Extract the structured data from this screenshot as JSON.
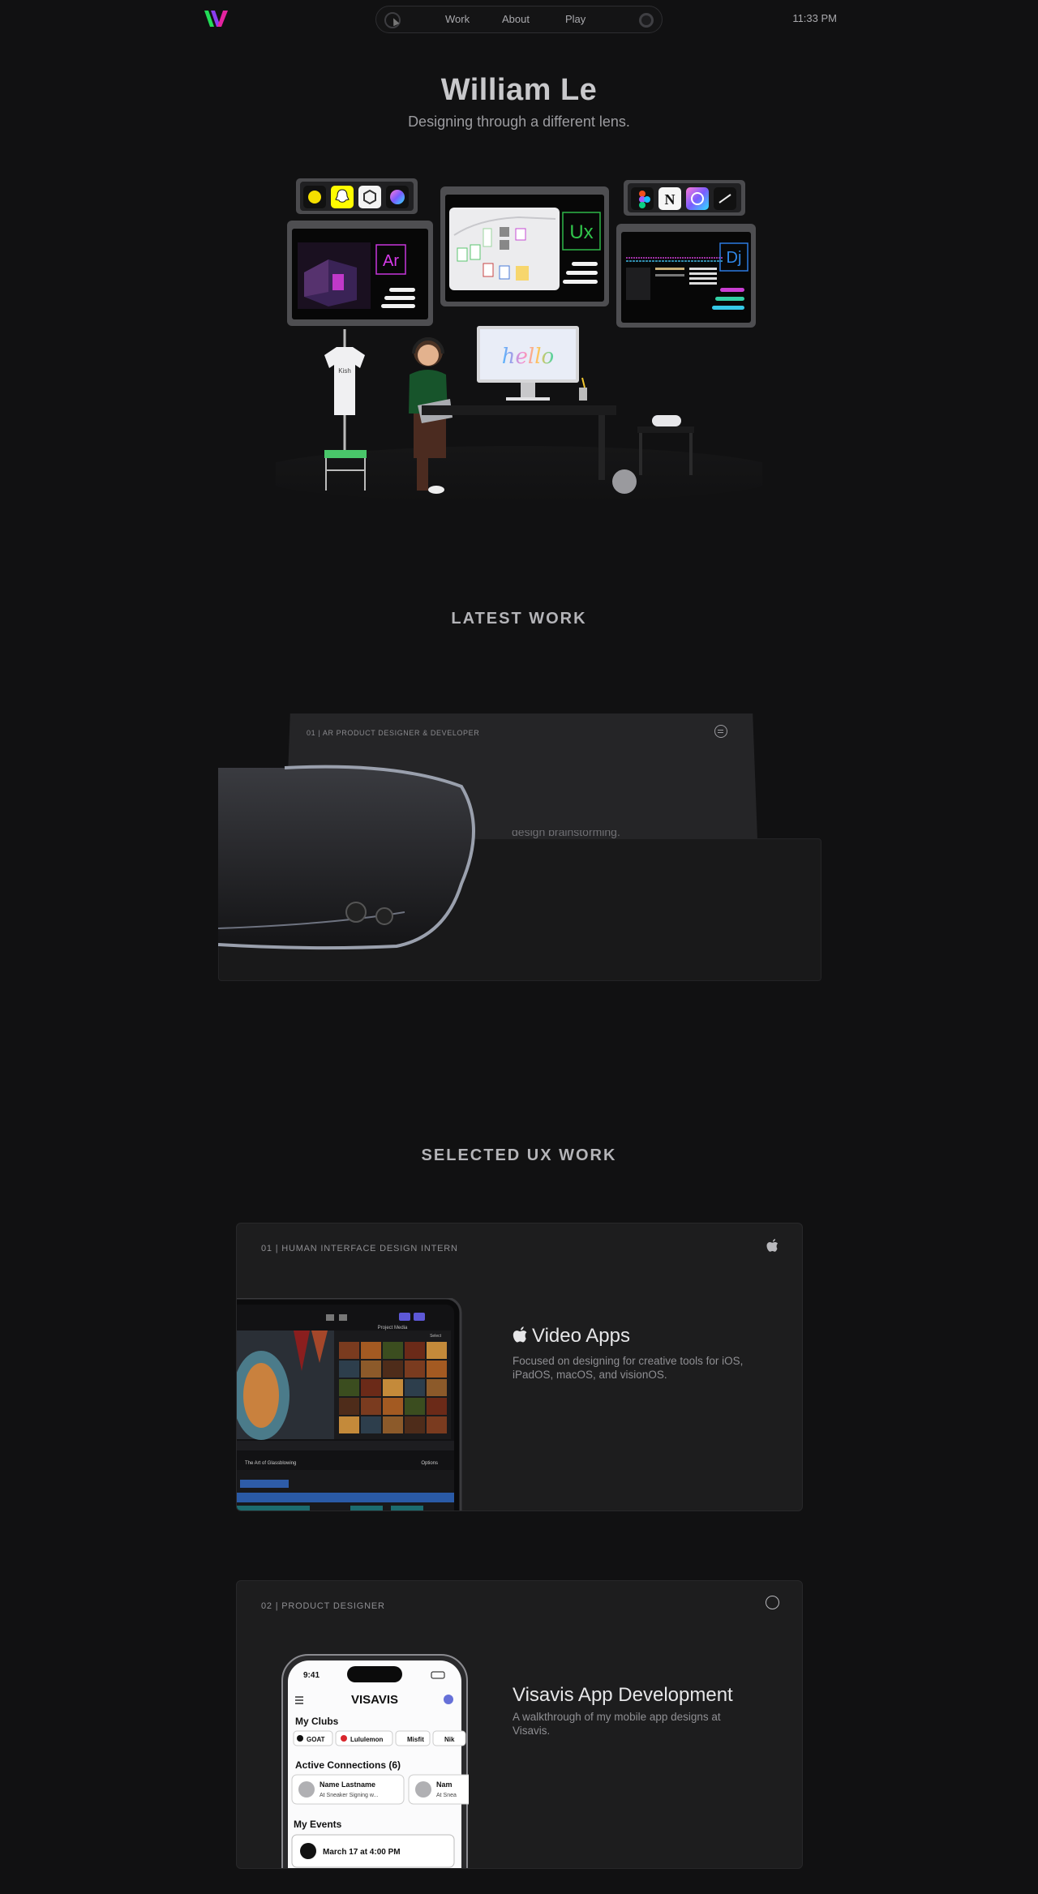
{
  "nav": {
    "logo": "W",
    "links": [
      "Work",
      "About",
      "Play"
    ],
    "clock": "11:33 PM"
  },
  "hero": {
    "name": "William Le",
    "tagline": "Designing through a different lens.",
    "scene": {
      "panel_tags": [
        "Ar",
        "Ux",
        "Dj"
      ],
      "monitor_text": "hello",
      "shirt_text": "Kish"
    }
  },
  "latest_work": {
    "heading": "LATEST WORK",
    "card": {
      "label": "01 | AR PRODUCT DESIGNER & DEVELOPER",
      "text": "design brainstorming."
    }
  },
  "selected_ux": {
    "heading": "SELECTED UX WORK",
    "cards": [
      {
        "label": "01 | HUMAN INTERFACE DESIGN INTERN",
        "title": "Video Apps",
        "desc": "Focused on designing for creative tools for iOS, iPadOS, macOS, and visionOS.",
        "ipad": {
          "header": "Project Media",
          "track_title": "The Art of Glassblowing",
          "options": "Options",
          "select": "Select"
        }
      },
      {
        "label": "02 | PRODUCT DESIGNER",
        "title": "Visavis App Development",
        "desc": "A walkthrough of my mobile app designs at Visavis.",
        "phone": {
          "time": "9:41",
          "app_name": "VISAVIS",
          "my_clubs": "My Clubs",
          "clubs": [
            "GOAT",
            "Lululemon",
            "Misfit",
            "Nik"
          ],
          "active_connections": "Active Connections (6)",
          "conn_name": "Name Lastname",
          "conn_sub": "At Sneaker Signing w...",
          "conn_name_2": "Nam",
          "conn_sub_2": "At Snea",
          "my_events": "My Events",
          "event": "March 17 at 4:00 PM"
        }
      }
    ]
  },
  "colors": {
    "background": "#111112",
    "card": "#1d1d1e",
    "logo_green": "#21e04d",
    "logo_magenta": "#e51ca7"
  }
}
